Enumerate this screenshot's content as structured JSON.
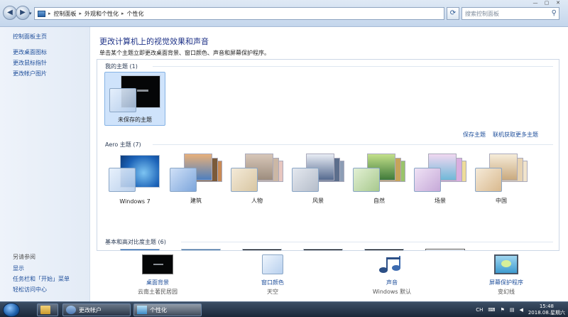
{
  "window": {
    "controls": [
      "—",
      "▢",
      "✕"
    ]
  },
  "nav": {
    "back": "◀",
    "forward": "▶",
    "dropdown": "▾"
  },
  "addressbar": {
    "crumbs": [
      "控制面板",
      "外观和个性化",
      "个性化"
    ],
    "separator": "▸"
  },
  "search": {
    "placeholder": "搜索控制面板"
  },
  "sidebar": {
    "items": [
      "控制面板主页",
      "更改桌面图标",
      "更改鼠标指针",
      "更改帐户图片"
    ],
    "see_also_title": "另请参阅",
    "see_also": [
      "显示",
      "任务栏和「开始」菜单",
      "轻松访问中心"
    ]
  },
  "main": {
    "heading": "更改计算机上的视觉效果和声音",
    "subheading": "单击某个主题立即更改桌面背景、窗口颜色、声音和屏幕保护程序。"
  },
  "themes": {
    "my_section": "我的主题 (1)",
    "my_themes": [
      {
        "name": "未保存的主题"
      }
    ],
    "save_link": "保存主题",
    "online_link": "联机获取更多主题",
    "aero_section": "Aero 主题 (7)",
    "aero_themes": [
      {
        "name": "Windows 7"
      },
      {
        "name": "建筑"
      },
      {
        "name": "人物"
      },
      {
        "name": "风景"
      },
      {
        "name": "自然"
      },
      {
        "name": "场景"
      },
      {
        "name": "中国"
      }
    ],
    "basic_section": "基本和高对比度主题 (6)"
  },
  "bottom": [
    {
      "label": "桌面背景",
      "sub": "云南土著民居园",
      "icon": "desktop-background-icon"
    },
    {
      "label": "窗口颜色",
      "sub": "天空",
      "icon": "window-color-icon"
    },
    {
      "label": "声音",
      "sub": "Windows 默认",
      "icon": "sound-icon"
    },
    {
      "label": "屏幕保护程序",
      "sub": "变幻线",
      "icon": "screensaver-icon"
    }
  ],
  "taskbar": {
    "buttons": [
      "更改帐户",
      "个性化"
    ],
    "lang": "CH",
    "time": "15:48",
    "date": "2018.08.星期六"
  }
}
